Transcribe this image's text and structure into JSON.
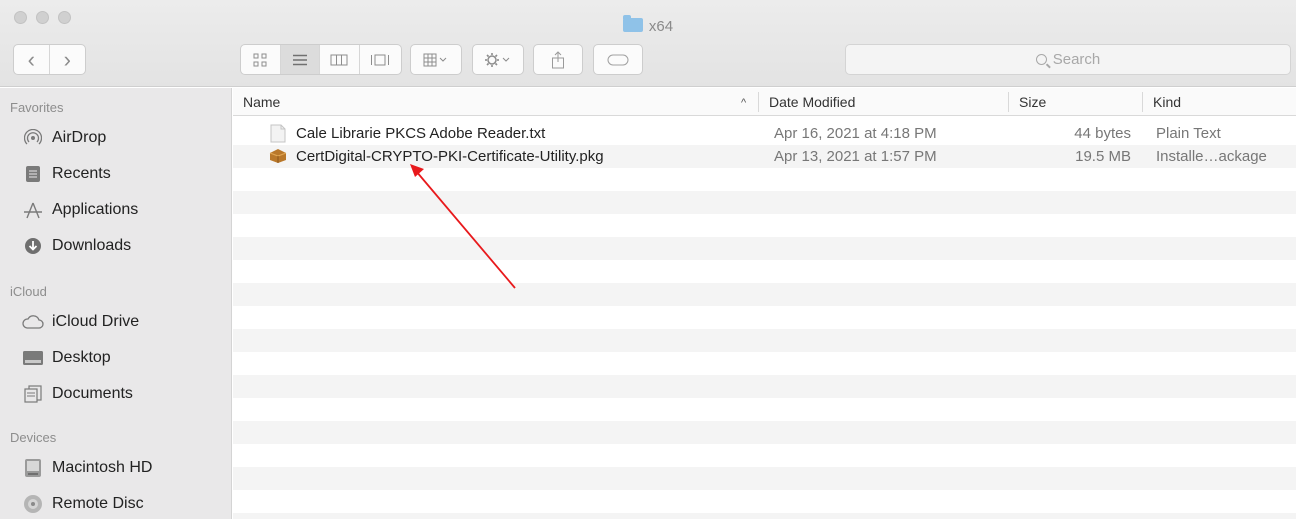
{
  "window": {
    "title": "x64",
    "accent_folder_color": "#8fc2e8"
  },
  "toolbar": {
    "nav_back": "‹",
    "nav_forward": "›",
    "view_modes": [
      "icon-view",
      "list-view",
      "column-view",
      "gallery-view"
    ],
    "active_view": "list-view",
    "search_placeholder": "Search"
  },
  "sidebar": {
    "sections": [
      {
        "title": "Favorites",
        "items": [
          {
            "label": "AirDrop",
            "icon": "airdrop-icon"
          },
          {
            "label": "Recents",
            "icon": "recents-icon"
          },
          {
            "label": "Applications",
            "icon": "applications-icon"
          },
          {
            "label": "Downloads",
            "icon": "downloads-icon"
          }
        ]
      },
      {
        "title": "iCloud",
        "items": [
          {
            "label": "iCloud Drive",
            "icon": "cloud-icon"
          },
          {
            "label": "Desktop",
            "icon": "desktop-icon"
          },
          {
            "label": "Documents",
            "icon": "documents-icon"
          }
        ]
      },
      {
        "title": "Devices",
        "items": [
          {
            "label": "Macintosh HD",
            "icon": "hard-drive-icon"
          },
          {
            "label": "Remote Disc",
            "icon": "disc-icon"
          }
        ]
      }
    ]
  },
  "columns": {
    "name": "Name",
    "sort_indicator": "^",
    "date_modified": "Date Modified",
    "size": "Size",
    "kind": "Kind"
  },
  "files": [
    {
      "name": "Cale Librarie PKCS Adobe Reader.txt",
      "date": "Apr 16, 2021 at 4:18 PM",
      "size": "44 bytes",
      "kind": "Plain Text",
      "icon": "text-file-icon"
    },
    {
      "name": "CertDigital-CRYPTO-PKI-Certificate-Utility.pkg",
      "date": "Apr 13, 2021 at 1:57 PM",
      "size": "19.5 MB",
      "kind": "Installe…ackage",
      "icon": "package-icon"
    }
  ],
  "annotation": {
    "arrow_color": "#e8191c"
  }
}
